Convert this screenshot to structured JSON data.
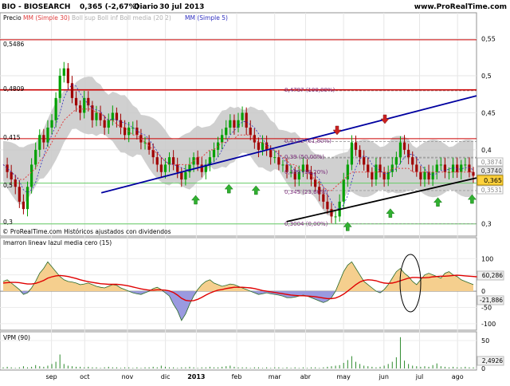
{
  "header": {
    "title": "BIO - BIOSEARCH",
    "quote": "0,365 (-2,67%)",
    "period": "Diario",
    "date": "30 jul 2013",
    "site": "www.ProRealTime.com"
  },
  "price_panel": {
    "legend": {
      "label": "Precio",
      "mm30": "MM (Simple 30)",
      "bollinger": "Boll sup Boll inf Boll media (20 2)",
      "mm5": "MM (Simple 5)"
    },
    "footer_text": "© ProRealTime.com Históricos ajustados con dividendos",
    "left_levels": [
      "0,5486",
      "0,4809",
      "0,415",
      "0,5",
      "0,3"
    ],
    "fib_labels": [
      "0,4797 (100,00%)",
      "0,4112 (61,80%)",
      "0,39 (50,00%)",
      "0,389 (38,20%)",
      "0,345 (23,60%)",
      "0,3004 (0,00%)"
    ],
    "right_boxes": {
      "v1": "0,3874",
      "v2": "0,3740",
      "v3": "0,365",
      "v4": "0,3531"
    }
  },
  "macd_panel": {
    "legend": "lmarron lineav lazul media cero (15)",
    "box_pos": "60,286",
    "box_neg": "-21,886"
  },
  "vpm_panel": {
    "legend": "VPM (90)",
    "box": "2,4926"
  },
  "colors": {
    "up_candle": "#00a000",
    "down_candle": "#a00000",
    "bollinger_fill": "#c8c8c8",
    "mm30": "#e04040",
    "mm5": "#3030c0",
    "resistance": "#cc0000",
    "support": "#66cc66",
    "trend_blue": "#0000a0",
    "trend_black": "#000000",
    "arrow_up": "#30b030",
    "arrow_down": "#cc2020",
    "current_box": "#ffd23c",
    "macd_pos": "#f5cf8e",
    "macd_neg": "#9a9ae0",
    "macd_line": "#e00000",
    "macd_green": "#60c840",
    "vpm": "#2e8b2e"
  },
  "chart_data": [
    {
      "type": "line",
      "name_panel": "price",
      "x": [
        "sep",
        "oct",
        "nov",
        "dic",
        "2013",
        "feb",
        "mar",
        "abr",
        "may",
        "jun",
        "jul",
        "ago"
      ],
      "ylim": [
        0.29,
        0.57
      ],
      "y_ticks": [
        "0,55",
        "0,5",
        "0,45",
        "0,4",
        "0,35",
        "0,3"
      ],
      "y_tick_values": [
        0.55,
        0.5,
        0.45,
        0.4,
        0.35,
        0.3
      ],
      "horizontal_levels": [
        0.5486,
        0.4809,
        0.415,
        0.355,
        0.3
      ],
      "fibonacci": [
        0.4797,
        0.4112,
        0.39,
        0.389,
        0.345,
        0.3004
      ],
      "close": [
        0.38,
        0.37,
        0.36,
        0.35,
        0.33,
        0.32,
        0.35,
        0.38,
        0.4,
        0.42,
        0.41,
        0.43,
        0.44,
        0.47,
        0.5,
        0.51,
        0.49,
        0.47,
        0.46,
        0.45,
        0.47,
        0.46,
        0.44,
        0.45,
        0.44,
        0.43,
        0.44,
        0.45,
        0.44,
        0.43,
        0.42,
        0.43,
        0.43,
        0.42,
        0.41,
        0.41,
        0.4,
        0.39,
        0.38,
        0.37,
        0.38,
        0.39,
        0.38,
        0.37,
        0.36,
        0.37,
        0.38,
        0.39,
        0.38,
        0.37,
        0.38,
        0.39,
        0.4,
        0.41,
        0.42,
        0.43,
        0.44,
        0.43,
        0.44,
        0.45,
        0.43,
        0.42,
        0.41,
        0.4,
        0.41,
        0.4,
        0.39,
        0.39,
        0.38,
        0.38,
        0.37,
        0.37,
        0.36,
        0.37,
        0.38,
        0.37,
        0.36,
        0.35,
        0.34,
        0.33,
        0.32,
        0.31,
        0.31,
        0.33,
        0.36,
        0.38,
        0.41,
        0.4,
        0.39,
        0.38,
        0.37,
        0.36,
        0.38,
        0.37,
        0.36,
        0.37,
        0.38,
        0.39,
        0.41,
        0.4,
        0.39,
        0.38,
        0.37,
        0.36,
        0.37,
        0.36,
        0.37,
        0.38,
        0.38,
        0.37,
        0.37,
        0.38,
        0.37,
        0.38,
        0.38,
        0.37,
        0.365
      ],
      "mm30": [
        0.38,
        0.375,
        0.37,
        0.365,
        0.36,
        0.36,
        0.365,
        0.37,
        0.375,
        0.385,
        0.39,
        0.4,
        0.41,
        0.42,
        0.43,
        0.44,
        0.445,
        0.45,
        0.455,
        0.455,
        0.455,
        0.455,
        0.455,
        0.45,
        0.45,
        0.445,
        0.44,
        0.44,
        0.435,
        0.43,
        0.43,
        0.425,
        0.42,
        0.42,
        0.415,
        0.41,
        0.405,
        0.4,
        0.395,
        0.39,
        0.385,
        0.38,
        0.38,
        0.38,
        0.38,
        0.38,
        0.38,
        0.385,
        0.39,
        0.39,
        0.395,
        0.4,
        0.4,
        0.405,
        0.41,
        0.41,
        0.415,
        0.415,
        0.42,
        0.42,
        0.42,
        0.42,
        0.415,
        0.41,
        0.41,
        0.405,
        0.4,
        0.4,
        0.395,
        0.39,
        0.385,
        0.38,
        0.38,
        0.375,
        0.37,
        0.37,
        0.365,
        0.36,
        0.355,
        0.35,
        0.345,
        0.345,
        0.35,
        0.355,
        0.36,
        0.365,
        0.37,
        0.37,
        0.37,
        0.37,
        0.37,
        0.37,
        0.37,
        0.37,
        0.37,
        0.37,
        0.375,
        0.375,
        0.375,
        0.375,
        0.375,
        0.37,
        0.37,
        0.37,
        0.37,
        0.37,
        0.37,
        0.37,
        0.37,
        0.37,
        0.37,
        0.37,
        0.37,
        0.37,
        0.37,
        0.37,
        0.37
      ],
      "trendlines": [
        {
          "name": "blue-resistance-trend",
          "from": [
            0.21,
            0.342
          ],
          "to": [
            1.0,
            0.473
          ]
        },
        {
          "name": "black-support-trend",
          "from": [
            0.6,
            0.303
          ],
          "to": [
            1.0,
            0.362
          ]
        }
      ]
    },
    {
      "type": "area",
      "name_panel": "macd",
      "ylim": [
        -110,
        130
      ],
      "y_ticks": [
        "100",
        "50",
        "0",
        "-50",
        "-100"
      ],
      "y_tick_values": [
        100,
        50,
        0,
        -50,
        -100
      ],
      "values": [
        30,
        35,
        25,
        15,
        5,
        -10,
        -5,
        10,
        30,
        55,
        70,
        90,
        75,
        60,
        45,
        35,
        30,
        28,
        25,
        20,
        22,
        25,
        20,
        15,
        12,
        10,
        15,
        20,
        18,
        10,
        5,
        0,
        -5,
        -8,
        -10,
        -5,
        0,
        8,
        12,
        5,
        -5,
        -15,
        -40,
        -60,
        -90,
        -70,
        -40,
        -15,
        5,
        20,
        30,
        35,
        25,
        20,
        15,
        18,
        22,
        20,
        15,
        10,
        5,
        0,
        -5,
        -10,
        -8,
        -5,
        -8,
        -10,
        -12,
        -15,
        -20,
        -20,
        -18,
        -15,
        -12,
        -15,
        -20,
        -25,
        -30,
        -35,
        -30,
        -20,
        0,
        30,
        60,
        80,
        90,
        70,
        50,
        30,
        20,
        10,
        0,
        -5,
        5,
        20,
        40,
        60,
        70,
        55,
        45,
        30,
        20,
        35,
        50,
        55,
        50,
        45,
        40,
        55,
        60,
        50,
        45,
        35,
        30,
        25,
        20
      ],
      "red_line": [
        25,
        26,
        27,
        27,
        26,
        24,
        22,
        22,
        24,
        28,
        33,
        40,
        44,
        47,
        48,
        47,
        45,
        42,
        39,
        35,
        32,
        29,
        27,
        25,
        23,
        22,
        21,
        21,
        21,
        20,
        18,
        16,
        13,
        10,
        7,
        5,
        3,
        3,
        4,
        4,
        3,
        1,
        -4,
        -12,
        -22,
        -28,
        -30,
        -29,
        -25,
        -19,
        -12,
        -6,
        -1,
        3,
        5,
        8,
        10,
        12,
        12,
        12,
        11,
        10,
        8,
        5,
        2,
        0,
        -2,
        -4,
        -6,
        -8,
        -10,
        -12,
        -13,
        -14,
        -14,
        -15,
        -16,
        -17,
        -19,
        -21,
        -23,
        -23,
        -21,
        -16,
        -9,
        0,
        10,
        20,
        28,
        33,
        35,
        34,
        32,
        28,
        25,
        24,
        25,
        28,
        32,
        36,
        40,
        42,
        42,
        41,
        41,
        42,
        44,
        45,
        46,
        46,
        47,
        48,
        49,
        48,
        47,
        46,
        45,
        44,
        43
      ]
    },
    {
      "type": "bar",
      "name_panel": "vpm",
      "ylim": [
        0,
        60
      ],
      "y_ticks": [
        "50",
        "0"
      ],
      "y_tick_values": [
        50,
        0
      ],
      "values": [
        2,
        3,
        2,
        1,
        2,
        4,
        2,
        3,
        6,
        4,
        3,
        5,
        8,
        12,
        25,
        8,
        5,
        4,
        3,
        3,
        2,
        3,
        2,
        2,
        1,
        2,
        3,
        2,
        2,
        1,
        2,
        2,
        1,
        2,
        1,
        2,
        2,
        3,
        2,
        5,
        3,
        2,
        2,
        1,
        2,
        2,
        3,
        2,
        1,
        2,
        2,
        3,
        2,
        2,
        3,
        4,
        5,
        3,
        2,
        2,
        2,
        1,
        2,
        2,
        1,
        2,
        1,
        2,
        2,
        1,
        2,
        1,
        2,
        1,
        2,
        1,
        2,
        2,
        1,
        2,
        3,
        4,
        5,
        6,
        10,
        15,
        22,
        12,
        8,
        5,
        4,
        3,
        2,
        3,
        5,
        8,
        12,
        20,
        56,
        14,
        8,
        5,
        4,
        3,
        4,
        3,
        6,
        9,
        4,
        3,
        2,
        3,
        2,
        2,
        3,
        2,
        2
      ]
    }
  ]
}
